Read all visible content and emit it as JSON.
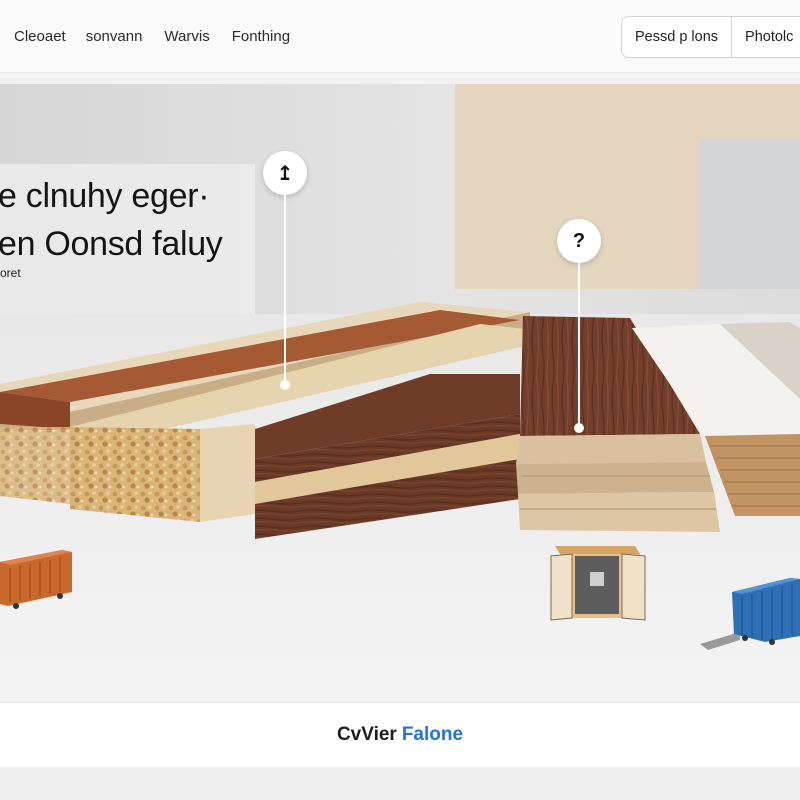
{
  "nav": {
    "links": [
      "Cleoaet",
      "sonvann",
      "Warvis",
      "Fonthing"
    ],
    "buttons": [
      "Pessd p lons",
      "Photolc"
    ]
  },
  "hero": {
    "headline_line1": "e clnuhy eger·",
    "headline_line2": "en Oonsd faluy",
    "subline": "oret",
    "pin_left_symbol": "↥",
    "pin_right_symbol": "?"
  },
  "footer": {
    "title_part1": "CvVier",
    "title_part2": "Falone"
  },
  "icons": [
    "arrow-up-icon",
    "question-icon",
    "shipping-container-icon",
    "open-container-icon",
    "container-truck-icon"
  ],
  "colors": {
    "accent_blue": "#1f74e0",
    "walnut": "#6e3b28",
    "cherry": "#a4552f",
    "oak_light": "#e7d6b4",
    "container_orange": "#c9692e",
    "container_blue": "#2f6fb5"
  }
}
